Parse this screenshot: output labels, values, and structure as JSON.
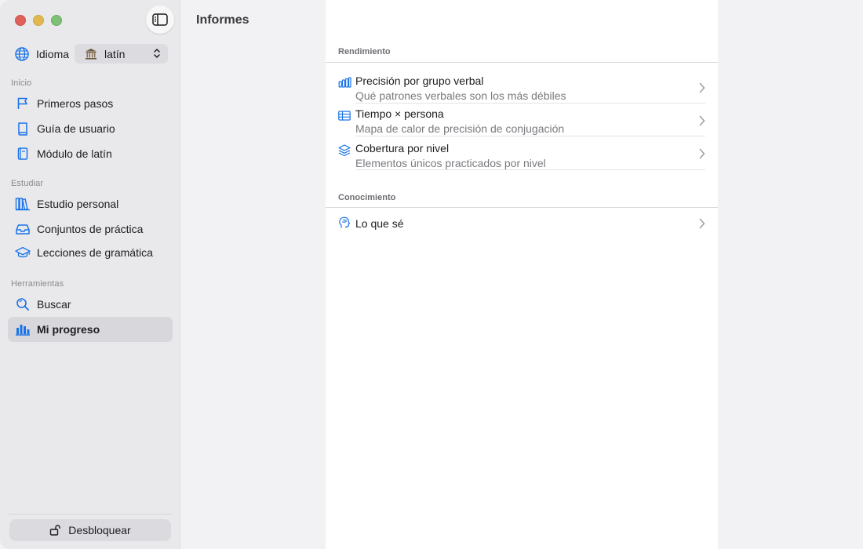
{
  "window": {
    "colors": {
      "accent": "#1a73e8",
      "sidebar_bg": "#e9e9ec",
      "selected_bg": "#d7d7dc"
    }
  },
  "sidebar": {
    "language": {
      "label": "Idioma",
      "value": "latín",
      "icon": "globe-icon",
      "value_icon": "temple-icon"
    },
    "sections": [
      {
        "title": "Inicio",
        "items": [
          {
            "label": "Primeros pasos",
            "icon": "flag-icon"
          },
          {
            "label": "Guía de usuario",
            "icon": "book-icon"
          },
          {
            "label": "Módulo de latín",
            "icon": "book-closed-icon"
          }
        ]
      },
      {
        "title": "Estudiar",
        "items": [
          {
            "label": "Estudio personal",
            "icon": "books-icon"
          },
          {
            "label": "Conjuntos de práctica",
            "icon": "tray-icon"
          },
          {
            "label": "Lecciones de gramática",
            "icon": "graduation-cap-icon"
          }
        ]
      },
      {
        "title": "Herramientas",
        "items": [
          {
            "label": "Buscar",
            "icon": "search-icon"
          },
          {
            "label": "Mi progreso",
            "icon": "bar-chart-icon",
            "selected": true
          }
        ]
      }
    ],
    "unlock_label": "Desbloquear"
  },
  "middle": {
    "title": "Informes"
  },
  "detail": {
    "groups": [
      {
        "header": "Rendimiento",
        "rows": [
          {
            "title": "Precisión por grupo verbal",
            "subtitle": "Qué patrones verbales son los más débiles",
            "icon": "bars-icon"
          },
          {
            "title": "Tiempo × persona",
            "subtitle": "Mapa de calor de precisión de conjugación",
            "icon": "table-icon"
          },
          {
            "title": "Cobertura por nivel",
            "subtitle": "Elementos únicos practicados por nivel",
            "icon": "layers-icon"
          }
        ]
      },
      {
        "header": "Conocimiento",
        "rows": [
          {
            "title": "Lo que sé",
            "icon": "head-icon"
          }
        ]
      }
    ]
  }
}
